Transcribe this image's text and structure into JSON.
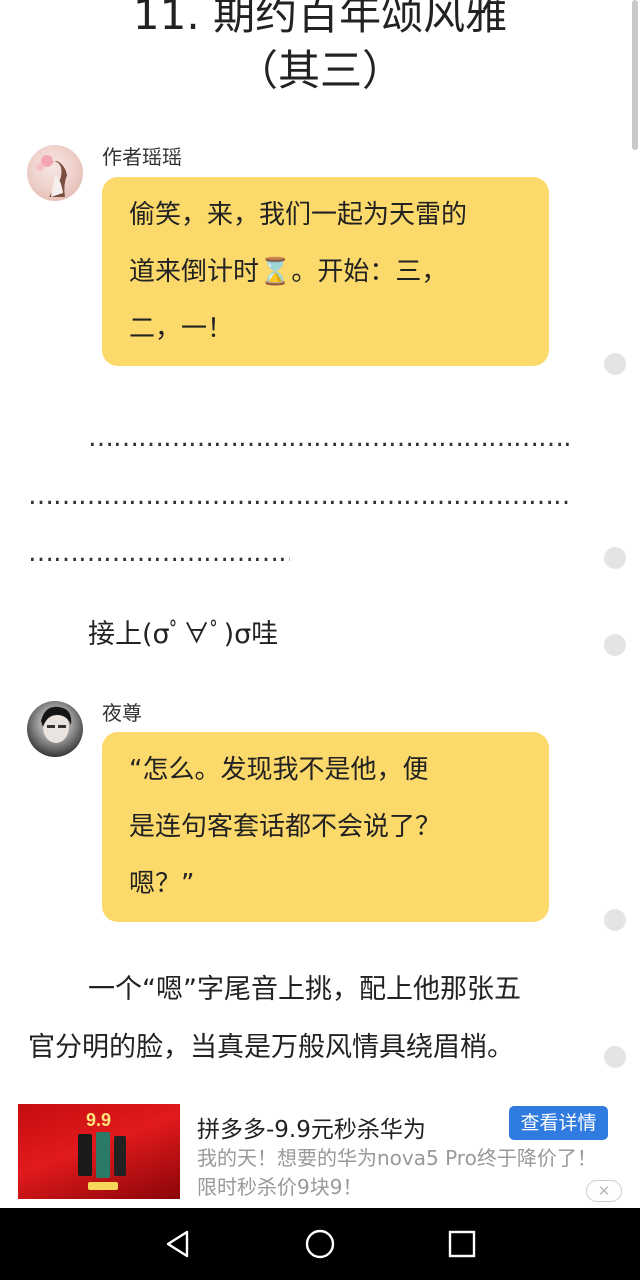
{
  "chapter": {
    "title_line1": "11. 期约百年颂风雅",
    "title_line2": "（其三）"
  },
  "messages": [
    {
      "author": "作者瑶瑶",
      "lines": [
        "偷笑，来，我们一起为天雷的",
        "道来倒计时⌛。开始：三，",
        "二，一！"
      ]
    },
    {
      "author": "夜尊",
      "lines": [
        "“怎么。发现我不是他，便",
        "是连句客套话都不会说了？",
        "嗯？”"
      ]
    }
  ],
  "narrative": {
    "dots_line1": "……………………………………………………",
    "dots_line2": "…………………………………………………………",
    "dots_line3": "……………………………",
    "reply": "接上(σﾟ∀ﾟ)σ哇",
    "para_line1": "一个“嗯”字尾音上挑，配上他那张五",
    "para_line2": "官分明的脸，当真是万般风情具绕眉梢。"
  },
  "ad": {
    "title": "拼多多-9.9元秒杀华为",
    "desc": "我的天！想要的华为nova5 Pro终于降价了！限时秒杀价9块9！",
    "button": "查看详情",
    "close": "✕",
    "thumb_price": "9.9"
  },
  "nav": {
    "back_icon": "back-triangle-icon",
    "home_icon": "home-circle-icon",
    "recent_icon": "recent-square-icon"
  },
  "colors": {
    "bubble": "#fcd96b",
    "ad_button": "#2f7be0"
  }
}
